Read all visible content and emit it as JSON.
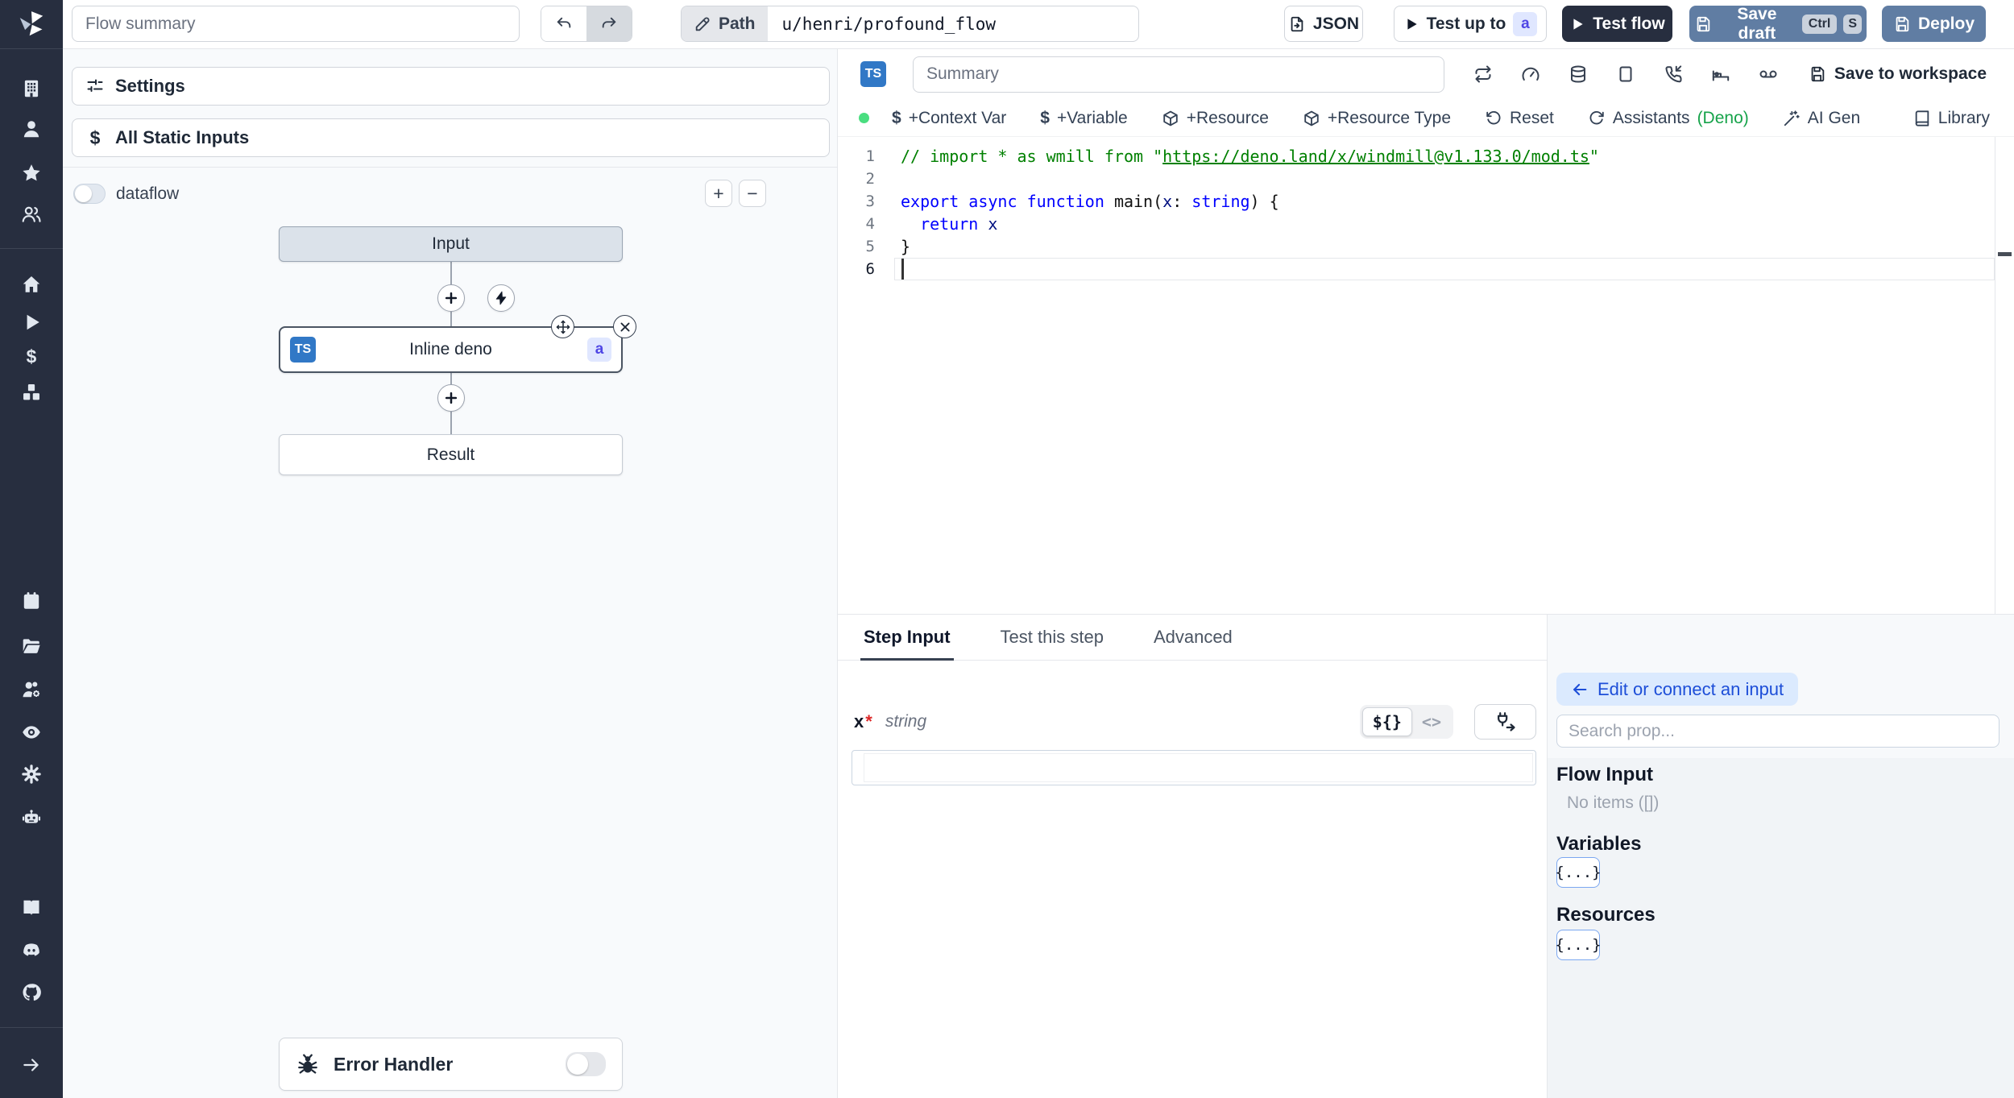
{
  "header": {
    "flow_summary_placeholder": "Flow summary",
    "path_label": "Path",
    "path_value": "u/henri/profound_flow",
    "json_button": "JSON",
    "test_up_to_label": "Test up to",
    "test_up_to_badge": "a",
    "test_flow_button": "Test flow",
    "save_draft_button": "Save draft",
    "save_draft_kbd": {
      "k1": "Ctrl",
      "k2": "S"
    },
    "deploy_button": "Deploy"
  },
  "sidebar": {
    "top_icons": [
      "building",
      "user",
      "star",
      "users"
    ],
    "mid_icons": [
      "home",
      "play",
      "dollar",
      "boxes"
    ],
    "lower_icons": [
      "calendar",
      "folder-open",
      "users-gear",
      "eye",
      "gear",
      "robot"
    ],
    "footer_icons": [
      "book",
      "discord",
      "github"
    ],
    "collapse_icon": "arrow-right"
  },
  "flow_panel": {
    "settings_button": "Settings",
    "static_inputs_button": "All Static Inputs",
    "dataflow_label": "dataflow",
    "dataflow_enabled": false,
    "zoom_in_label": "+",
    "zoom_out_label": "−",
    "graph": {
      "input_node": "Input",
      "step_node": {
        "lang_badge": "TS",
        "label": "Inline deno",
        "id_badge": "a"
      },
      "result_node": "Result"
    },
    "error_handler": {
      "label": "Error Handler",
      "enabled": false
    }
  },
  "editor": {
    "lang_badge": "TS",
    "summary_placeholder": "Summary",
    "head_icons": [
      "repeat",
      "gauge",
      "database",
      "square",
      "phone-incoming",
      "bed",
      "voicemail"
    ],
    "save_to_workspace": "Save to workspace",
    "toolbar": {
      "status_dot_color": "#4ade80",
      "buttons": [
        {
          "icon": "dollar-text",
          "label": "+Context Var",
          "name": "add-context-var-button"
        },
        {
          "icon": "dollar-text",
          "label": "+Variable",
          "name": "add-variable-button"
        },
        {
          "icon": "package",
          "label": "+Resource",
          "name": "add-resource-button"
        },
        {
          "icon": "package",
          "label": "+Resource Type",
          "name": "add-resource-type-button"
        },
        {
          "icon": "rotate-ccw",
          "label": "Reset",
          "name": "reset-button"
        },
        {
          "icon": "refresh-cw",
          "label": "Assistants",
          "suffix": "(Deno)",
          "name": "assistants-button"
        },
        {
          "icon": "wand",
          "label": "AI Gen",
          "name": "ai-gen-button"
        }
      ],
      "library_button": "Library"
    },
    "code": {
      "language_colors": {
        "comment": "#008000",
        "keyword": "#0000ff",
        "identifier": "#001080",
        "plain": "#111111"
      },
      "lines": [
        {
          "n": 1,
          "segs": [
            {
              "t": "// import * as wmill from \"",
              "c": "cm"
            },
            {
              "t": "https://deno.land/x/windmill@v1.133.0/mod.ts",
              "c": "cm u"
            },
            {
              "t": "\"",
              "c": "cm"
            }
          ]
        },
        {
          "n": 2,
          "segs": []
        },
        {
          "n": 3,
          "segs": [
            {
              "t": "export",
              "c": "kw"
            },
            {
              "t": " ",
              "c": "pl"
            },
            {
              "t": "async",
              "c": "kw"
            },
            {
              "t": " ",
              "c": "pl"
            },
            {
              "t": "function",
              "c": "kw"
            },
            {
              "t": " ",
              "c": "pl"
            },
            {
              "t": "main",
              "c": "fn"
            },
            {
              "t": "(",
              "c": "pl"
            },
            {
              "t": "x",
              "c": "id"
            },
            {
              "t": ": ",
              "c": "pl"
            },
            {
              "t": "string",
              "c": "kw"
            },
            {
              "t": ") {",
              "c": "pl"
            }
          ]
        },
        {
          "n": 4,
          "segs": [
            {
              "t": "  ",
              "c": "pl"
            },
            {
              "t": "return",
              "c": "kw"
            },
            {
              "t": " ",
              "c": "pl"
            },
            {
              "t": "x",
              "c": "id"
            }
          ]
        },
        {
          "n": 5,
          "segs": [
            {
              "t": "}",
              "c": "pl"
            }
          ]
        },
        {
          "n": 6,
          "segs": [],
          "cursor": true,
          "current": true
        }
      ]
    }
  },
  "step_panel": {
    "tabs": [
      {
        "label": "Step Input",
        "active": true
      },
      {
        "label": "Test this step",
        "active": false
      },
      {
        "label": "Advanced",
        "active": false
      }
    ],
    "field": {
      "name": "x",
      "required_mark": "*",
      "type": "string",
      "value": "",
      "expr_toggle": "${}",
      "code_toggle": "<>"
    }
  },
  "connect_panel": {
    "back_button": "Edit or connect an input",
    "search_placeholder": "Search prop...",
    "flow_input_title": "Flow Input",
    "flow_input_empty": "No items ([])",
    "variables_title": "Variables",
    "variables_button": "{...}",
    "resources_title": "Resources",
    "resources_button": "{...}"
  },
  "colors": {
    "accent_blue": "#1d4ed8",
    "deno_green": "#16a34a",
    "status_green": "#4ade80",
    "primary_dark": "#272e3f",
    "action_slate_blue": "#607da3",
    "ts_badge_blue": "#3178c6"
  }
}
